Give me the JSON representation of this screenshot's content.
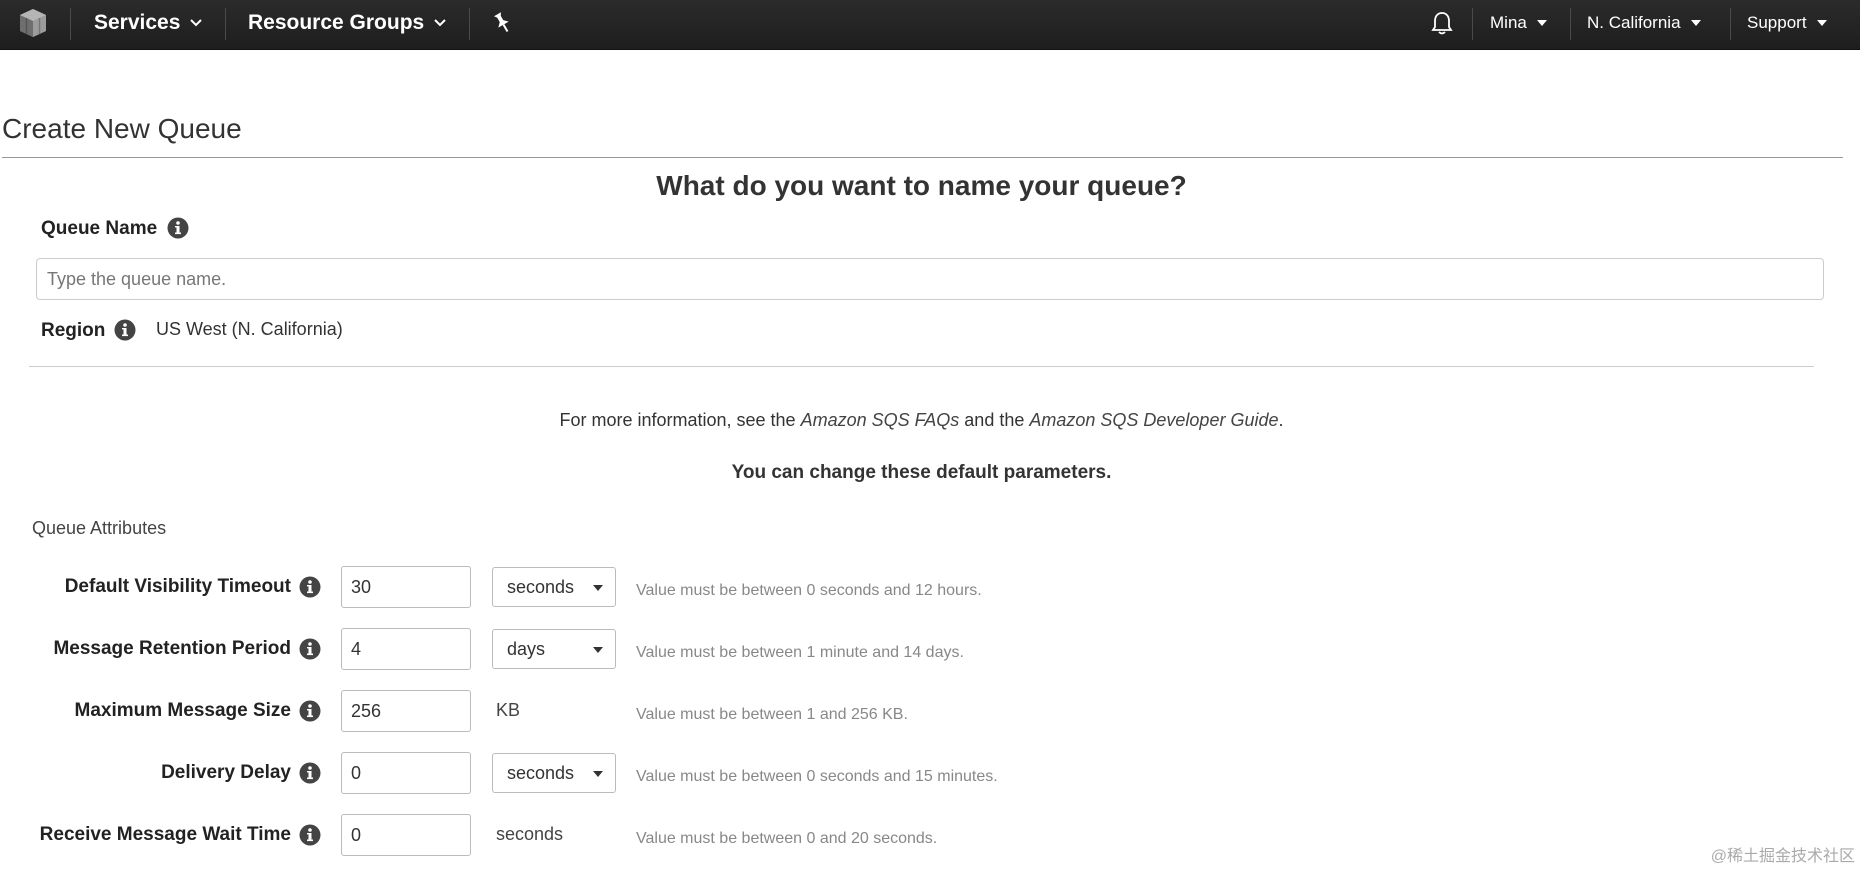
{
  "nav": {
    "services": "Services",
    "resource_groups": "Resource Groups",
    "user": "Mina",
    "region": "N. California",
    "support": "Support"
  },
  "page": {
    "title": "Create New Queue",
    "question": "What do you want to name your queue?",
    "queue_name_label": "Queue Name",
    "queue_name_placeholder": "Type the queue name.",
    "queue_name_value": "",
    "region_label": "Region",
    "region_value": "US West (N. California)",
    "info_prefix": "For more information, see the ",
    "faq_link": "Amazon SQS FAQs",
    "info_mid": " and the ",
    "guide_link": "Amazon SQS Developer Guide",
    "info_suffix": ".",
    "defaults_text": "You can change these default parameters.",
    "section_title": "Queue Attributes"
  },
  "attributes": [
    {
      "label": "Default Visibility Timeout",
      "value": "30",
      "unit": "seconds",
      "unit_is_select": true,
      "hint": "Value must be between 0 seconds and 12 hours."
    },
    {
      "label": "Message Retention Period",
      "value": "4",
      "unit": "days",
      "unit_is_select": true,
      "hint": "Value must be between 1 minute and 14 days."
    },
    {
      "label": "Maximum Message Size",
      "value": "256",
      "unit": "KB",
      "unit_is_select": false,
      "hint": "Value must be between 1 and 256 KB."
    },
    {
      "label": "Delivery Delay",
      "value": "0",
      "unit": "seconds",
      "unit_is_select": true,
      "hint": "Value must be between 0 seconds and 15 minutes."
    },
    {
      "label": "Receive Message Wait Time",
      "value": "0",
      "unit": "seconds",
      "unit_is_select": false,
      "hint": "Value must be between 0 and 20 seconds."
    }
  ],
  "watermark": "@稀土掘金技术社区",
  "icons": {
    "logo": "aws-cube-icon",
    "pin": "pin-icon",
    "notifications": "bell-icon",
    "info": "info-icon",
    "caret": "caret-down-icon"
  },
  "colors": {
    "nav_bg": "#232323",
    "hint_text": "#888888",
    "border": "#bbbbbb"
  }
}
